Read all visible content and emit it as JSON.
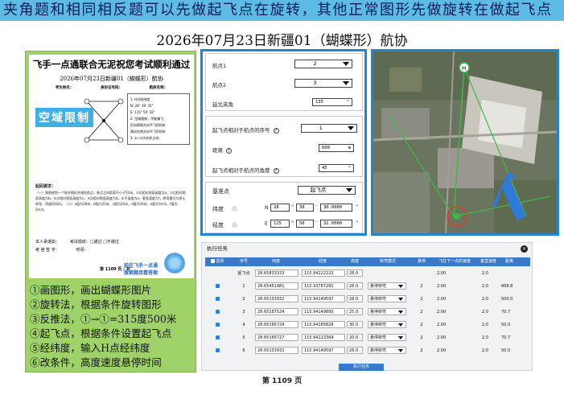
{
  "banner": "夹角题和相同相反题可以先做起飞点在旋转，其他正常图形先做旋转在做起飞点",
  "subtitle": "2026年07月23日新疆01（蝴蝶形）航协",
  "doc": {
    "title": "飞手一点通联合无泥祝您考试顺利通过",
    "subtitle": "2026年07月23日新疆01（蝴蝶形）航协",
    "field_name": "考生姓名：",
    "field_id": "身份证号码：",
    "field_school": "航校名称：",
    "stamp": "空域限制",
    "conds": [
      "1. H点经纬度",
      "N: 28° 39' 35\"",
      "E: 115° 54' 32\"",
      "2. 空域限制，不能偏飞",
      "负向两侧方向平飞600米",
      "两向东侧方向平飞500米",
      "3. ①→②为向东方向"
    ],
    "req_title": "起码要求：",
    "req_text": "（一）按图规划一个联合图形并储存航点，各点之间距离不小于50米。①点相对地面高度为a，②点相对地面高度为b。③点相对地面高度为c。④点相对地面高度为d。水平速度为e，垂直速度为f，转弯模式为停止转弯，停留时间2s。（二）a值为28米，b值为25米，c值为30米，d值为20米，e值为3m/s，f值为2m/s。",
    "sign1": "本人承诺如：",
    "sign1b": "考试成绩：□通过 □不通过",
    "sign2": "考 官 签 字：",
    "sign2b": "时间：",
    "page": "第 1109 页 / 共",
    "promo": "前往飞手一点通\n搜索题目看答案"
  },
  "steps": [
    "①画图形，画出蝴蝶形图片",
    "②旋转法，根据条件旋转图形",
    "③反推法，①→①=315度500米",
    "④起飞点，根据条件设置起飞点",
    "⑤经纬度，输入H点经纬度",
    "⑥改条件，高度速度悬停时间"
  ],
  "settings": {
    "wp1_label": "航点1",
    "wp1_value": "2",
    "wp2_label": "航点2",
    "wp2_value": "3",
    "angle_label": "延北夹角",
    "angle_value": "135",
    "angle_unit": "°",
    "seq_label": "起飞点相对于航点的序号",
    "seq_value": "1",
    "dist_label": "距离",
    "dist_value": "600",
    "dist_unit": "m",
    "rel_angle_label": "起飞点相对于航点的角度",
    "rel_angle_value": "45",
    "rel_angle_unit": "°",
    "base_label": "基准点",
    "base_value": "起飞点",
    "lat_label": "纬度",
    "lat_dir": "N",
    "lat_deg": "28",
    "lat_min": "39",
    "lat_sec": "30.0000",
    "lon_label": "经度",
    "lon_dir": "E",
    "lon_deg": "115",
    "lon_min": "56",
    "lon_sec": "32.0000",
    "help": "?"
  },
  "task": {
    "title": "执行任务",
    "close": "×",
    "headers": [
      "选择",
      "序号",
      "纬度",
      "经度",
      "高度",
      "转弯模式",
      "悬停",
      "飞往下一点的速度",
      "垂直速度",
      "距离"
    ],
    "rows": [
      {
        "idx": "起飞点",
        "lat": "28.65833333",
        "lon": "115.94222222",
        "alt": "28.0",
        "mode": "",
        "hover": "",
        "speed": "2.00",
        "vspeed": "2.0",
        "dist": "",
        "checked": false
      },
      {
        "idx": "1",
        "lat": "28.65451981",
        "lon": "115.93787281",
        "alt": "28.0",
        "mode": "悬停转弯",
        "hover": "2",
        "speed": "2.00",
        "vspeed": "2.0",
        "dist": "608.8",
        "checked": true
      },
      {
        "idx": "2",
        "lat": "28.65133932",
        "lon": "115.94149597",
        "alt": "28.0",
        "mode": "悬停转弯",
        "hover": "2",
        "speed": "2.00",
        "vspeed": "2.0",
        "dist": "500.0",
        "checked": true
      },
      {
        "idx": "3",
        "lat": "28.65187524",
        "lon": "115.94149895",
        "alt": "25.0",
        "mode": "悬停转弯",
        "hover": "2",
        "speed": "2.00",
        "vspeed": "2.0",
        "dist": "70.7",
        "checked": true
      },
      {
        "idx": "4",
        "lat": "28.65165729",
        "lon": "115.94185828",
        "alt": "30.0",
        "mode": "悬停转弯",
        "hover": "2",
        "speed": "2.00",
        "vspeed": "2.0",
        "dist": "50.0",
        "checked": true
      },
      {
        "idx": "5",
        "lat": "28.65165727",
        "lon": "115.94113364",
        "alt": "20.0",
        "mode": "悬停转弯",
        "hover": "2",
        "speed": "2.00",
        "vspeed": "2.0",
        "dist": "70.7",
        "checked": true
      },
      {
        "idx": "6",
        "lat": "28.65133932",
        "lon": "115.94149597",
        "alt": "28.0",
        "mode": "悬停转弯",
        "hover": "2",
        "speed": "2.00",
        "vspeed": "2.0",
        "dist": "50.0",
        "checked": true
      }
    ],
    "exec_label": "执行任务"
  },
  "map": {
    "marker_label": "H"
  },
  "page_no": "第 1109 页",
  "colors": {
    "accent": "#1f86d1",
    "banner": "#5dbbe6",
    "doc_bg": "#9fd36a",
    "table_head": "#3a79c9"
  }
}
